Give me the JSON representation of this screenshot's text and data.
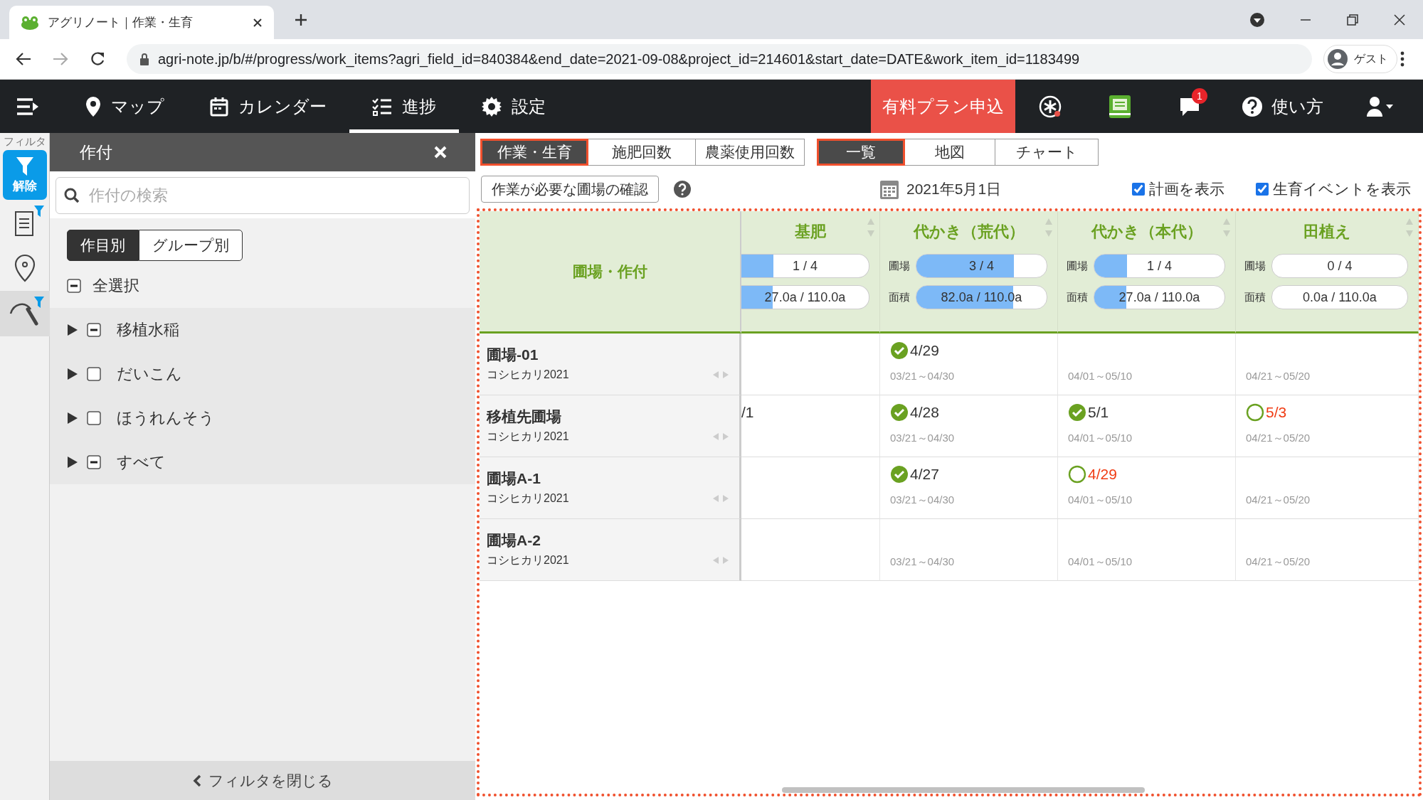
{
  "browser": {
    "tab_title": "アグリノート｜作業・生育",
    "address": "agri-note.jp/b/#/progress/work_items?agri_field_id=840384&end_date=2021-09-08&project_id=214601&start_date=DATE&work_item_id=1183499",
    "profile": "ゲスト"
  },
  "nav": {
    "items": [
      {
        "kind": "map",
        "label": "マップ",
        "selected": false
      },
      {
        "kind": "calendar",
        "label": "カレンダー",
        "selected": false
      },
      {
        "kind": "progress",
        "label": "進捗",
        "selected": true
      },
      {
        "kind": "settings",
        "label": "設定",
        "selected": false
      }
    ],
    "plan_button": "有料プラン申込",
    "notification_count": "1",
    "help": "使い方"
  },
  "sidebar": {
    "title": "フィルタ",
    "release": "解除",
    "tools": [
      {
        "kind": "document",
        "filtered": true,
        "selected": false
      },
      {
        "kind": "pin",
        "filtered": false,
        "selected": false
      },
      {
        "kind": "scythe",
        "filtered": true,
        "selected": true
      }
    ]
  },
  "filter": {
    "title": "作付",
    "search": {
      "placeholder": "作付の検索"
    },
    "segments": [
      {
        "label": "作目別",
        "selected": true
      },
      {
        "label": "グループ別",
        "selected": false
      }
    ],
    "select_all": {
      "label": "全選択",
      "indeterminate": true
    },
    "items": [
      {
        "label": "移植水稲",
        "indeterminate": true
      },
      {
        "label": "だいこん",
        "indeterminate": false
      },
      {
        "label": "ほうれんそう",
        "indeterminate": false
      },
      {
        "label": "すべて",
        "indeterminate": true
      }
    ],
    "close": "フィルタを閉じる"
  },
  "view_tabs": [
    {
      "label": "作業・生育",
      "selected": true
    },
    {
      "label": "施肥回数",
      "selected": false
    },
    {
      "label": "農薬使用回数",
      "selected": false
    }
  ],
  "display_tabs": [
    {
      "label": "一覧",
      "selected": true
    },
    {
      "label": "地図",
      "selected": false
    },
    {
      "label": "チャート",
      "selected": false
    }
  ],
  "check_button": "作業が必要な圃場の確認",
  "date": "2021年5月1日",
  "options": [
    {
      "label": "計画を表示",
      "checked": true
    },
    {
      "label": "生育イベントを表示",
      "checked": true
    }
  ],
  "table": {
    "corner": "圃場・作付",
    "columns": [
      {
        "title": "基肥",
        "meters": [
          {
            "value": "1 / 4",
            "level": 0.25
          },
          {
            "value": "27.0a / 110.0a",
            "level": 0.245
          }
        ]
      },
      {
        "title": "代かき（荒代）",
        "meters": [
          {
            "label": "圃場",
            "value": "3 / 4",
            "level": 0.75
          },
          {
            "label": "面積",
            "value": "82.0a / 110.0a",
            "level": 0.745
          }
        ]
      },
      {
        "title": "代かき（本代）",
        "meters": [
          {
            "label": "圃場",
            "value": "1 / 4",
            "level": 0.25
          },
          {
            "label": "面積",
            "value": "27.0a / 110.0a",
            "level": 0.245
          }
        ]
      },
      {
        "title": "田植え",
        "meters": [
          {
            "label": "圃場",
            "value": "0 / 4",
            "level": 0
          },
          {
            "label": "面積",
            "value": "0.0a / 110.0a",
            "level": 0
          }
        ]
      }
    ],
    "rows": [
      {
        "field": "圃場-01",
        "crop": "コシヒカリ2021",
        "cells": [
          {},
          {
            "done": true,
            "date": "4/29",
            "period": "03/21～04/30"
          },
          {
            "period": "04/01～05/10"
          },
          {
            "period": "04/21～05/20"
          }
        ]
      },
      {
        "field": "移植先圃場",
        "crop": "コシヒカリ2021",
        "cells": [
          {
            "date": "/1"
          },
          {
            "done": true,
            "date": "4/28",
            "period": "03/21～04/30"
          },
          {
            "done": true,
            "date": "5/1",
            "period": "04/01～05/10"
          },
          {
            "done": false,
            "date": "5/3",
            "period": "04/21～05/20"
          }
        ]
      },
      {
        "field": "圃場A-1",
        "crop": "コシヒカリ2021",
        "cells": [
          {},
          {
            "done": true,
            "date": "4/27",
            "period": "03/21～04/30"
          },
          {
            "done": false,
            "date": "4/29",
            "period": "04/01～05/10"
          },
          {
            "period": "04/21～05/20"
          }
        ]
      },
      {
        "field": "圃場A-2",
        "crop": "コシヒカリ2021",
        "cells": [
          {},
          {
            "period": "03/21～04/30"
          },
          {
            "period": "04/01～05/10"
          },
          {
            "period": "04/21～05/20"
          }
        ]
      }
    ]
  }
}
